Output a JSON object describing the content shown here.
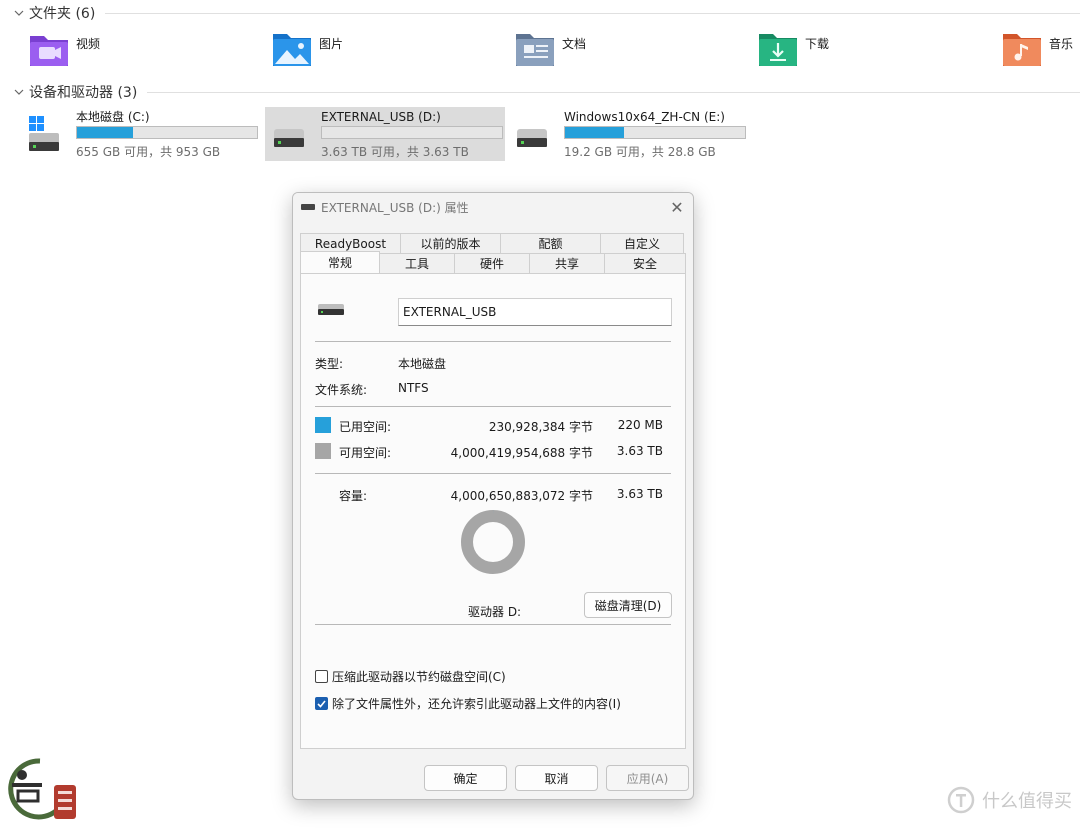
{
  "explorer": {
    "folders_header": "文件夹 (6)",
    "devices_header": "设备和驱动器 (3)",
    "folders": [
      {
        "label": "视频",
        "icon": "video-folder-icon",
        "color": "#8b4ad9"
      },
      {
        "label": "图片",
        "icon": "pictures-folder-icon",
        "color": "#1e8be0"
      },
      {
        "label": "文档",
        "icon": "documents-folder-icon",
        "color": "#6e87a8"
      },
      {
        "label": "下载",
        "icon": "downloads-folder-icon",
        "color": "#1f9e72"
      },
      {
        "label": "音乐",
        "icon": "music-folder-icon",
        "color": "#e86a3c"
      }
    ],
    "drives": [
      {
        "name": "本地磁盘 (C:)",
        "space": "655 GB 可用，共 953 GB",
        "used_fraction": 0.31,
        "icon": "windows-drive-icon",
        "selected": false
      },
      {
        "name": "EXTERNAL_USB (D:)",
        "space": "3.63 TB 可用，共 3.63 TB",
        "used_fraction": 0.0,
        "icon": "hard-drive-icon",
        "selected": true
      },
      {
        "name": "Windows10x64_ZH-CN (E:)",
        "space": "19.2 GB 可用，共 28.8 GB",
        "used_fraction": 0.33,
        "icon": "hard-drive-icon",
        "selected": false
      }
    ]
  },
  "dialog": {
    "title": "EXTERNAL_USB (D:) 属性",
    "close_glyph": "✕",
    "tabs_top": [
      "ReadyBoost",
      "以前的版本",
      "配额",
      "自定义"
    ],
    "tabs_bottom": [
      "常规",
      "工具",
      "硬件",
      "共享",
      "安全"
    ],
    "active_tab": "常规",
    "volume_name": "EXTERNAL_USB",
    "type_label": "类型:",
    "type_value": "本地磁盘",
    "fs_label": "文件系统:",
    "fs_value": "NTFS",
    "used_label": "已用空间:",
    "used_bytes": "230,928,384 字节",
    "used_human": "220 MB",
    "free_label": "可用空间:",
    "free_bytes": "4,000,419,954,688 字节",
    "free_human": "3.63 TB",
    "capacity_label": "容量:",
    "capacity_bytes": "4,000,650,883,072 字节",
    "capacity_human": "3.63 TB",
    "used_color": "#26a0da",
    "free_color": "#a6a6a6",
    "used_fraction": 0.0001,
    "drive_label": "驱动器 D:",
    "cleanup_button": "磁盘清理(D)",
    "compress_label": "压缩此驱动器以节约磁盘空间(C)",
    "compress_checked": false,
    "index_label": "除了文件属性外，还允许索引此驱动器上文件的内容(I)",
    "index_checked": true,
    "ok_button": "确定",
    "cancel_button": "取消",
    "apply_button": "应用(A)"
  },
  "watermark": {
    "right_text": "什么值得买"
  }
}
